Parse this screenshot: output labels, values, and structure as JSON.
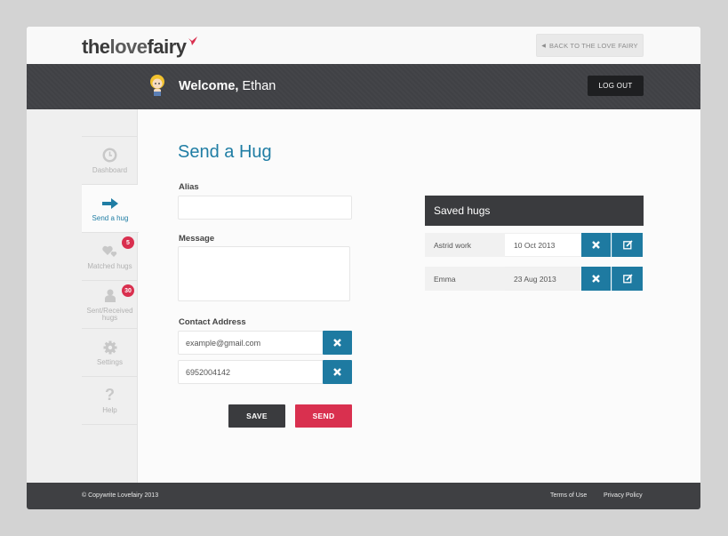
{
  "brand": {
    "logo_part1": "the",
    "logo_part2": "love",
    "logo_part3": "fairy"
  },
  "topbar": {
    "back_label": "BACK TO THE LOVE FAIRY"
  },
  "header": {
    "welcome_bold": "Welcome,",
    "user_name": "Ethan",
    "logout_label": "LOG OUT"
  },
  "sidebar": {
    "items": [
      {
        "label": "Dashboard",
        "icon": "clock-icon",
        "active": false
      },
      {
        "label": "Send a hug",
        "icon": "arrow-right-icon",
        "active": true
      },
      {
        "label": "Matched hugs",
        "icon": "hearts-icon",
        "badge": "5"
      },
      {
        "label": "Sent/Received hugs",
        "icon": "person-icon",
        "badge": "30"
      },
      {
        "label": "Settings",
        "icon": "gear-icon"
      },
      {
        "label": "Help",
        "icon": "question-icon"
      }
    ]
  },
  "form": {
    "title": "Send a Hug",
    "alias_label": "Alias",
    "alias_value": "",
    "message_label": "Message",
    "message_value": "",
    "contact_label": "Contact Address",
    "contacts": [
      "example@gmail.com",
      "6952004142"
    ],
    "save_label": "SAVE",
    "send_label": "SEND"
  },
  "saved": {
    "title": "Saved hugs",
    "rows": [
      {
        "name": "Astrid work",
        "date": "10 Oct 2013"
      },
      {
        "name": "Emma",
        "date": "23 Aug 2013"
      }
    ]
  },
  "footer": {
    "copyright": "© Copywrite Lovefairy 2013",
    "terms": "Terms of Use",
    "privacy": "Privacy Policy"
  },
  "colors": {
    "accent": "#1e7aa1",
    "brand_red": "#d9304f",
    "dark_bar": "#414246"
  }
}
